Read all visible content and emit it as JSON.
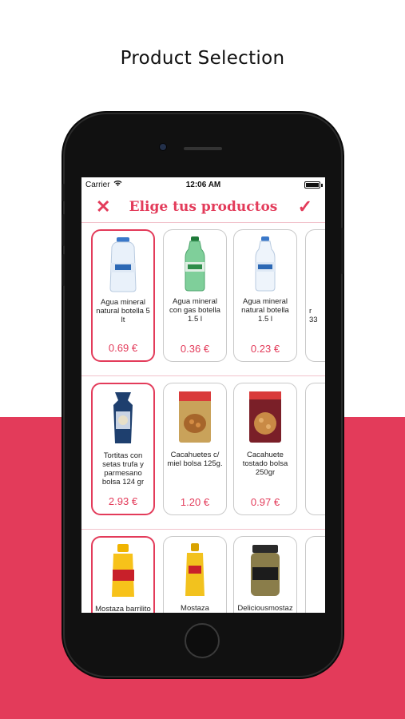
{
  "promo": {
    "title": "Product Selection"
  },
  "status_bar": {
    "carrier": "Carrier",
    "time": "12:06 AM"
  },
  "nav": {
    "title": "Elige tus productos",
    "close_icon": "✕",
    "confirm_icon": "✓"
  },
  "colors": {
    "accent": "#e33b5a",
    "card_border": "#c9c9c9"
  },
  "rows": [
    {
      "products": [
        {
          "name": "Agua mineral natural botella 5 lt",
          "price": "0.69 €",
          "selected": true,
          "icon": "water-bottle-icon"
        },
        {
          "name": "Agua mineral con gas botella 1.5 l",
          "price": "0.36 €",
          "selected": false,
          "icon": "sparkling-water-bottle-icon"
        },
        {
          "name": "Agua mineral natural botella 1.5 l",
          "price": "0.23 €",
          "selected": false,
          "icon": "water-bottle-icon"
        }
      ],
      "partial_card_text": "r\n33"
    },
    {
      "products": [
        {
          "name": "Tortitas con setas trufa y parmesano bolsa 124 gr",
          "price": "2.93 €",
          "selected": true,
          "icon": "rice-cakes-bag-icon"
        },
        {
          "name": "Cacahuetes c/ miel bolsa 125g.",
          "price": "1.20 €",
          "selected": false,
          "icon": "peanuts-bag-icon"
        },
        {
          "name": "Cacahuete tostado bolsa 250gr",
          "price": "0.97 €",
          "selected": false,
          "icon": "roasted-peanuts-bag-icon"
        }
      ]
    },
    {
      "products": [
        {
          "name": "Mostaza barrilito",
          "price": "",
          "selected": true,
          "icon": "mustard-bottle-icon"
        },
        {
          "name": "Mostaza",
          "price": "",
          "selected": false,
          "icon": "mustard-bottle-icon"
        },
        {
          "name": "Deliciousmostaz",
          "price": "",
          "selected": false,
          "icon": "mustard-jar-icon"
        }
      ]
    }
  ]
}
